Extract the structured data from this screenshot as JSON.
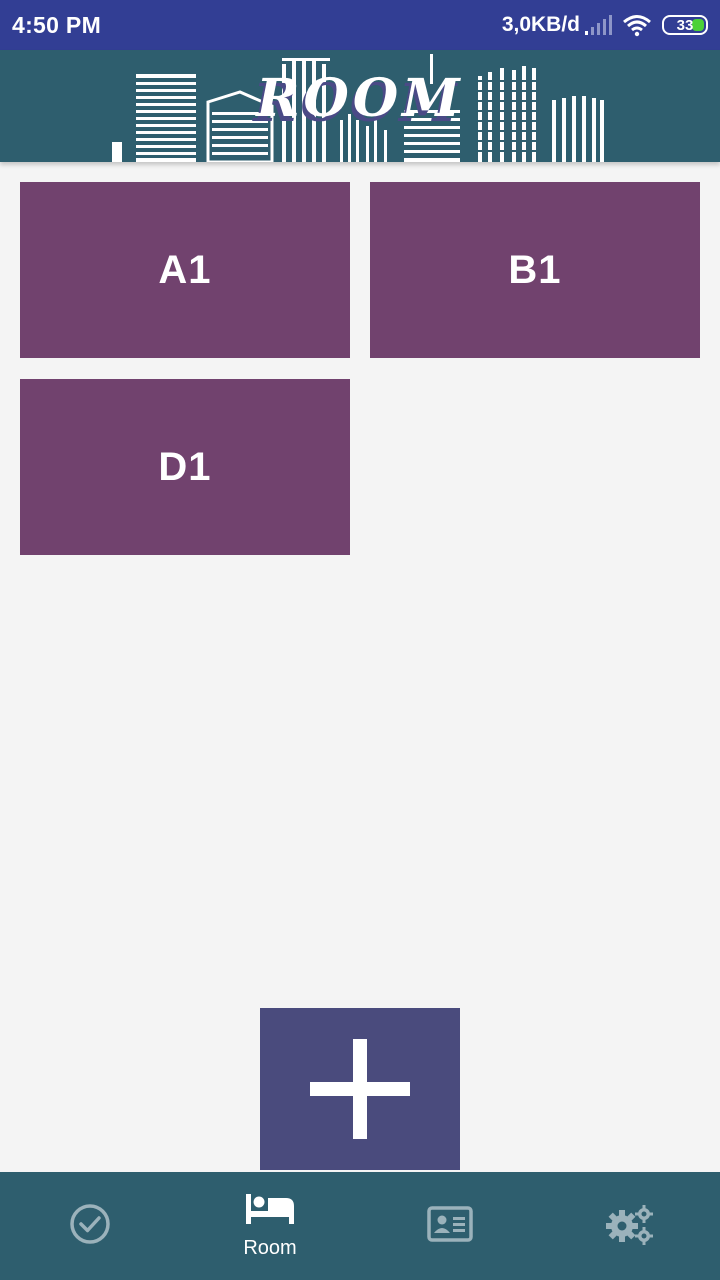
{
  "status_bar": {
    "time": "4:50 PM",
    "network_speed": "3,0KB/d",
    "battery_level": "33",
    "icons": [
      "signal-icon",
      "wifi-icon",
      "battery-icon"
    ]
  },
  "header": {
    "title": "ROOM"
  },
  "rooms": [
    {
      "label": "A1"
    },
    {
      "label": "B1"
    },
    {
      "label": "D1"
    }
  ],
  "add_button": {
    "icon": "plus-icon"
  },
  "bottom_nav": {
    "items": [
      {
        "icon": "check-circle-icon",
        "label": ""
      },
      {
        "icon": "bed-icon",
        "label": "Room",
        "active": true
      },
      {
        "icon": "id-card-icon",
        "label": ""
      },
      {
        "icon": "gears-icon",
        "label": ""
      }
    ]
  },
  "colors": {
    "status_bar": "#323e94",
    "header": "#2e5e6e",
    "room_tile": "#71426e",
    "add_button": "#4a4b7d",
    "background": "#f4f4f4",
    "nav_inactive_icon": "#9bb2bb",
    "nav_active_icon": "#ffffff"
  }
}
